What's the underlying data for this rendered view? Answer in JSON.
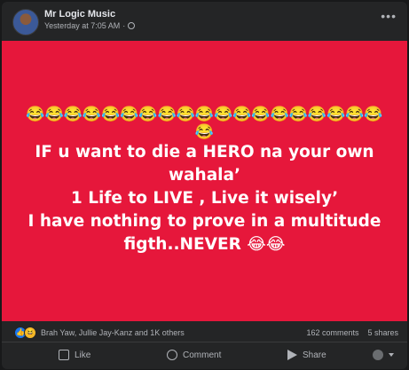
{
  "post": {
    "author": "Mr Logic Music",
    "timestamp": "Yesterday at 7:05 AM",
    "privacy_icon": "globe-icon",
    "more_icon": "more-options-icon",
    "background_color": "#e6173b",
    "emoji_row": "😂😂😂😂😂😂😂😂😂😂😂😂😂😂😂😂😂😂😂😂",
    "lines": [
      "IF u want to die a HERO na your own",
      "wahala’",
      "1 Life to LIVE , Live it wisely’",
      "I have nothing to prove in a multitude",
      "figth..NEVER 😂😂"
    ]
  },
  "reactions": {
    "names": "Brah Yaw, Jullie Jay-Kanz and 1K others",
    "comments": "162 comments",
    "shares": "5 shares"
  },
  "actions": {
    "like": "Like",
    "comment": "Comment",
    "share": "Share"
  }
}
